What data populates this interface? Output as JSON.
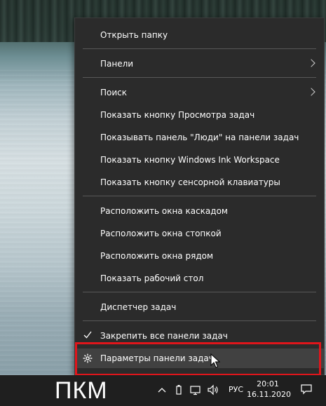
{
  "menu": {
    "items": [
      {
        "label": "Открыть папку"
      },
      {
        "label": "Панели",
        "submenu": true
      },
      {
        "label": "Поиск",
        "submenu": true
      },
      {
        "label": "Показать кнопку Просмотра задач"
      },
      {
        "label": "Показывать панель \"Люди\" на панели задач"
      },
      {
        "label": "Показать кнопку Windows Ink Workspace"
      },
      {
        "label": "Показать кнопку сенсорной клавиатуры"
      },
      {
        "label": "Расположить окна каскадом"
      },
      {
        "label": "Расположить окна стопкой"
      },
      {
        "label": "Расположить окна рядом"
      },
      {
        "label": "Показать рабочий стол"
      },
      {
        "label": "Диспетчер задач"
      },
      {
        "label": "Закрепить все панели задач",
        "checked": true
      },
      {
        "label": "Параметры панели задач",
        "icon": "gear-icon",
        "highlighted": true
      }
    ]
  },
  "annotation": {
    "text": "ПКМ",
    "color": "#e0151b"
  },
  "taskbar": {
    "language": "РУС",
    "time": "20:01",
    "date": "16.11.2020",
    "tray_icons": [
      "chevron-up-icon",
      "usb-icon",
      "network-icon",
      "volume-icon",
      "notification-icon"
    ]
  },
  "colors": {
    "menu_bg": "#2b2b2b",
    "menu_hover": "#414141",
    "separator": "#585858",
    "taskbar_bg": "#1f1f1f",
    "text": "#ffffff"
  }
}
